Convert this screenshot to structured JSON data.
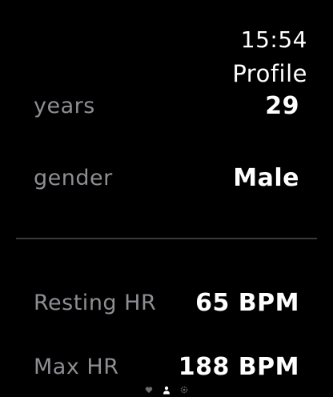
{
  "status_bar": {
    "time": "15:54"
  },
  "header": {
    "title": "Profile"
  },
  "profile": {
    "rows": [
      {
        "label": "years",
        "value": "29"
      },
      {
        "label": "gender",
        "value": "Male"
      },
      {
        "label": "Resting HR",
        "value": "65 BPM"
      },
      {
        "label": "Max HR",
        "value": "188 BPM"
      }
    ]
  },
  "page_indicator": {
    "pages": [
      "heart-icon",
      "person-icon",
      "gear-icon"
    ],
    "active_index": 1
  },
  "colors": {
    "background": "#000000",
    "label": "#8e8e93",
    "value": "#ffffff",
    "divider": "#3a3a3c"
  }
}
